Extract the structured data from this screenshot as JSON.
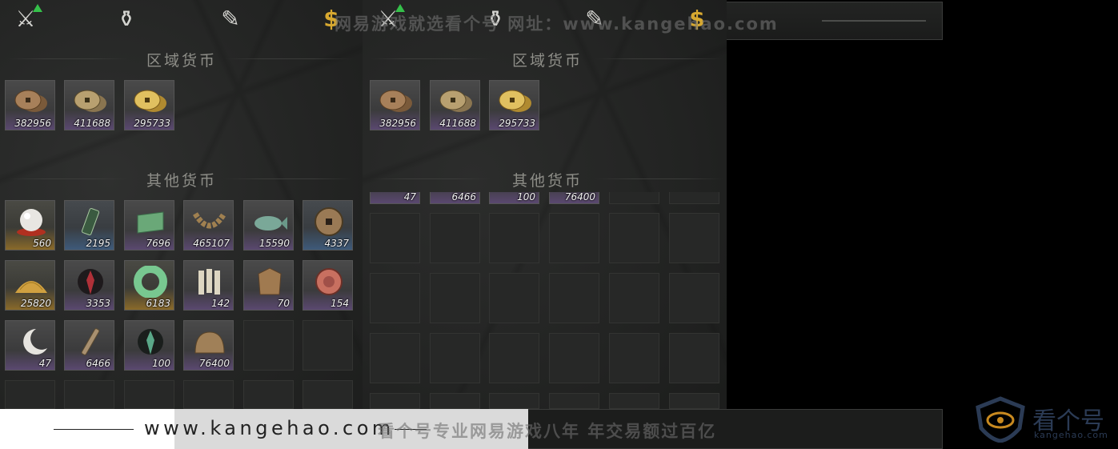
{
  "sections": {
    "regional": "区域货币",
    "other": "其他货币"
  },
  "regional_items": [
    {
      "qty": "382956",
      "icon": "copper-coins-icon"
    },
    {
      "qty": "411688",
      "icon": "bronze-coins-icon"
    },
    {
      "qty": "295733",
      "icon": "gold-coins-icon"
    }
  ],
  "other_items": [
    {
      "qty": "560",
      "icon": "pearl-icon"
    },
    {
      "qty": "2195",
      "icon": "jade-token-icon"
    },
    {
      "qty": "7696",
      "icon": "jade-note-icon"
    },
    {
      "qty": "465107",
      "icon": "coin-string-icon"
    },
    {
      "qty": "15590",
      "icon": "jade-fish-icon"
    },
    {
      "qty": "4337",
      "icon": "square-hole-coin-icon"
    },
    {
      "qty": "25820",
      "icon": "grain-pile-icon"
    },
    {
      "qty": "3353",
      "icon": "red-crystal-icon"
    },
    {
      "qty": "6183",
      "icon": "jade-ring-icon"
    },
    {
      "qty": "142",
      "icon": "bamboo-slips-icon"
    },
    {
      "qty": "70",
      "icon": "bronze-plaque-icon"
    },
    {
      "qty": "154",
      "icon": "red-medallion-icon"
    },
    {
      "qty": "47",
      "icon": "crescent-moon-icon"
    },
    {
      "qty": "6466",
      "icon": "coin-sword-icon"
    },
    {
      "qty": "100",
      "icon": "green-crystal-icon"
    },
    {
      "qty": "76400",
      "icon": "bronze-bell-icon"
    }
  ],
  "right_cut_row": [
    "47",
    "6466",
    "100",
    "76400"
  ],
  "watermark_top": "网易游戏就选看个号   网址：www.kangehao.com",
  "watermark_bottom": "看个号专业网易游戏八年   年交易额过百亿",
  "site_url": "www.kangehao.com",
  "logo_name": "看个号",
  "logo_url": "kangehao.com",
  "colors": {
    "accent_gold": "#d8a930",
    "badge_green": "#35c04a"
  }
}
